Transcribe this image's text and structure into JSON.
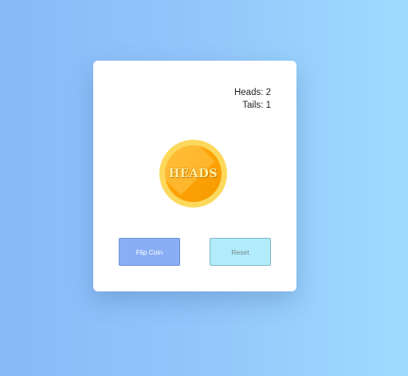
{
  "score": {
    "heads_label": "Heads: 2",
    "tails_label": "Tails: 1"
  },
  "coin": {
    "face": "HEADS"
  },
  "buttons": {
    "flip_label": "Flip Coin",
    "reset_label": "Reset"
  },
  "colors": {
    "background_left": "#89b9f7",
    "background_right": "#9ddcfe",
    "coin_rim": "#fcd95c",
    "coin_face": "#ffa206",
    "flip_button": "#8aaef5",
    "reset_button": "#b2ecfb"
  }
}
